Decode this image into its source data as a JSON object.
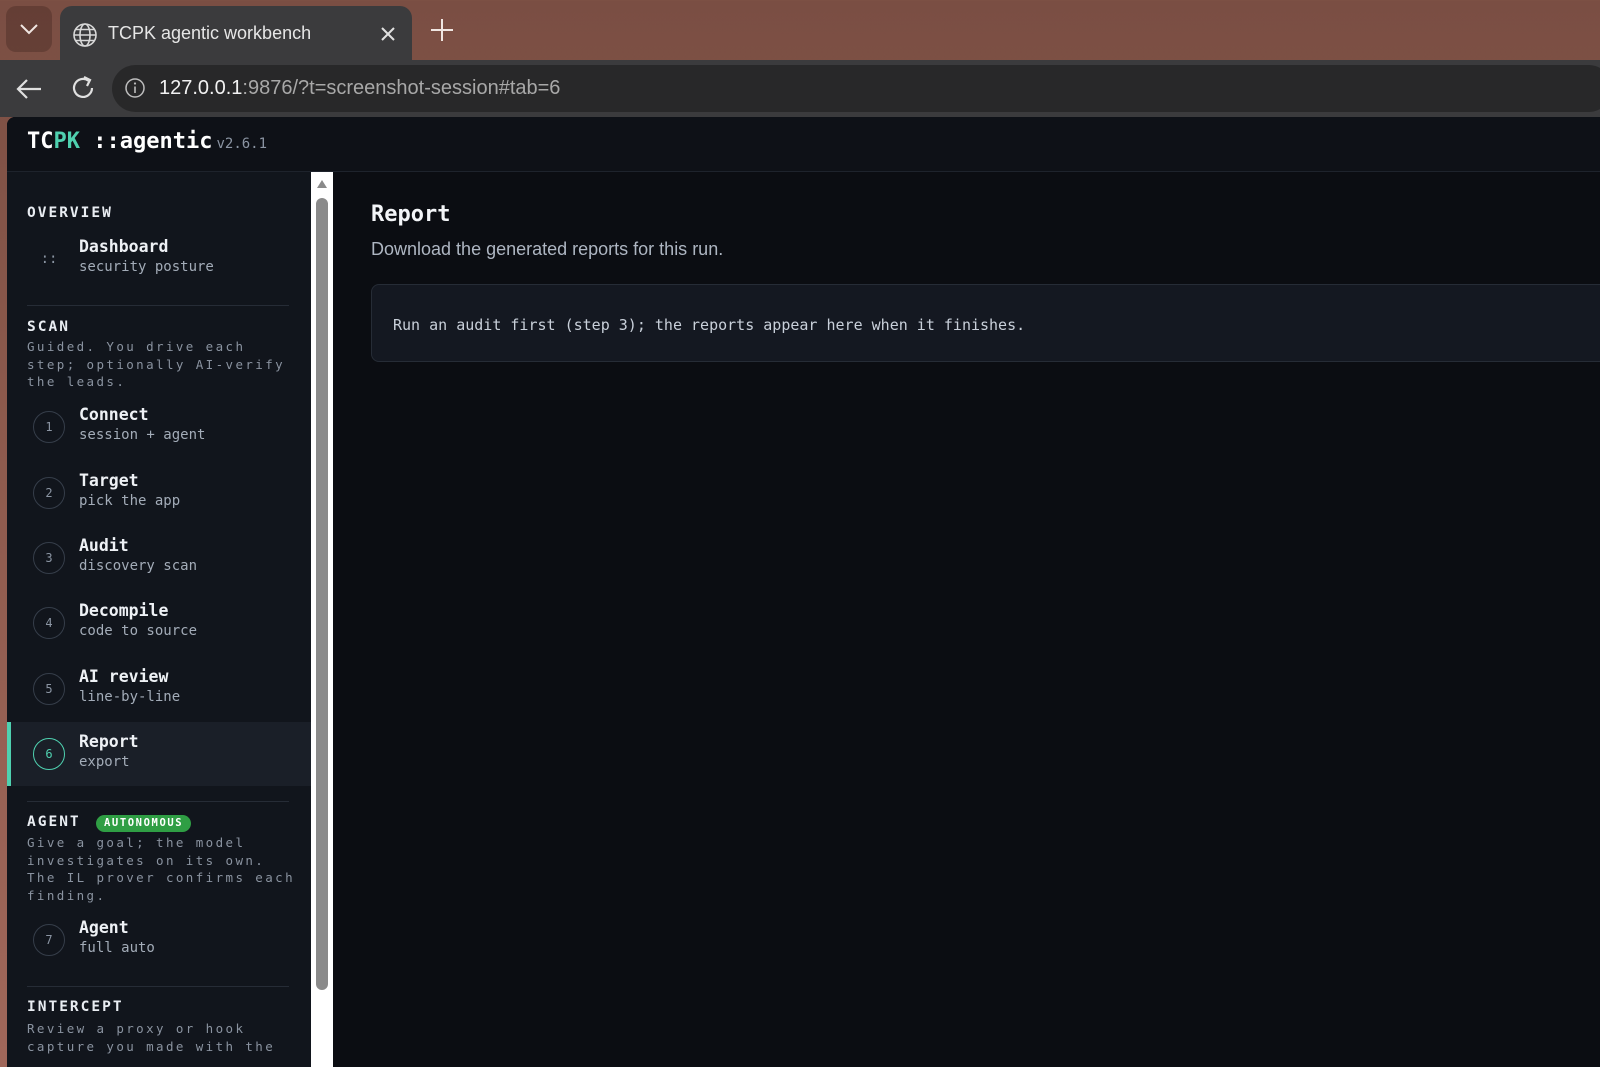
{
  "browser": {
    "tab_title": "TCPK agentic workbench",
    "url_host": "127.0.0.1",
    "url_rest": ":9876/?t=screenshot-session#tab=6"
  },
  "app": {
    "brand_tc": "TC",
    "brand_pk": "PK",
    "brand_suffix": "::agentic",
    "version": "v2.6.1"
  },
  "sidebar": {
    "overview": {
      "heading": "OVERVIEW",
      "items": [
        {
          "icon": "::",
          "label": "Dashboard",
          "sub": "security posture"
        }
      ]
    },
    "scan": {
      "heading": "SCAN",
      "desc": "Guided. You drive each step; optionally AI-verify the leads.",
      "items": [
        {
          "num": "1",
          "label": "Connect",
          "sub": "session + agent"
        },
        {
          "num": "2",
          "label": "Target",
          "sub": "pick the app"
        },
        {
          "num": "3",
          "label": "Audit",
          "sub": "discovery scan"
        },
        {
          "num": "4",
          "label": "Decompile",
          "sub": "code to source"
        },
        {
          "num": "5",
          "label": "AI review",
          "sub": "line-by-line"
        },
        {
          "num": "6",
          "label": "Report",
          "sub": "export",
          "active": true
        }
      ]
    },
    "agent": {
      "heading": "AGENT",
      "badge": "AUTONOMOUS",
      "desc": "Give a goal; the model investigates on its own. The IL prover confirms each finding.",
      "items": [
        {
          "num": "7",
          "label": "Agent",
          "sub": "full auto"
        }
      ]
    },
    "intercept": {
      "heading": "INTERCEPT",
      "desc": "Review a proxy or hook capture you made with the"
    }
  },
  "main": {
    "title": "Report",
    "subtitle": "Download the generated reports for this run.",
    "notice": "Run an audit first (step 3); the reports appear here when it finishes."
  },
  "colors": {
    "accent": "#4fd1b0",
    "badge": "#2f9e44",
    "background": "#0b0d12",
    "sidebar": "#11151c"
  },
  "icons": [
    "tab-list-chevron-icon",
    "globe-icon",
    "close-icon",
    "plus-icon",
    "back-arrow-icon",
    "reload-icon",
    "info-icon",
    "scroll-up-arrow-icon"
  ]
}
